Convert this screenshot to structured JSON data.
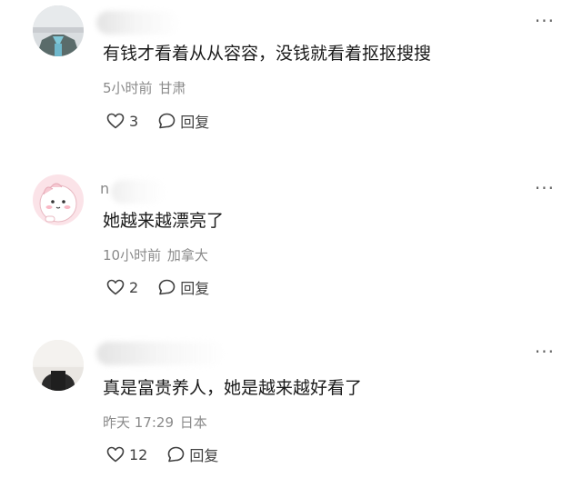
{
  "comments": [
    {
      "username": "",
      "text": "有钱才看着从从容容，没钱就看着抠抠搜搜",
      "time": "5小时前",
      "location": "甘肃",
      "likes": "3",
      "reply_label": "回复",
      "more_label": "···"
    },
    {
      "username": "n",
      "text": "她越来越漂亮了",
      "time": "10小时前",
      "location": "加拿大",
      "likes": "2",
      "reply_label": "回复",
      "more_label": "···"
    },
    {
      "username": "",
      "text": "真是富贵养人，她是越来越好看了",
      "time": "昨天 17:29",
      "location": "日本",
      "likes": "12",
      "reply_label": "回复",
      "more_label": "···"
    }
  ]
}
